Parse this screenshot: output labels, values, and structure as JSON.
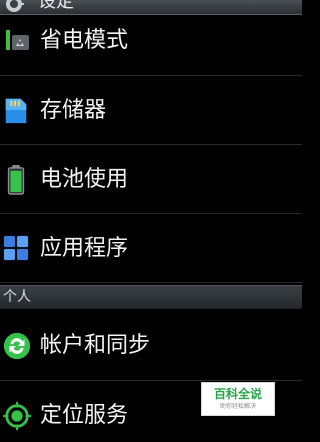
{
  "header": {
    "title": "设定",
    "icon": "gear-icon"
  },
  "items": [
    {
      "label": "省电模式",
      "icon": "power-saving-icon"
    },
    {
      "label": "存储器",
      "icon": "storage-icon"
    },
    {
      "label": "电池使用",
      "icon": "battery-icon"
    },
    {
      "label": "应用程序",
      "icon": "apps-grid-icon"
    }
  ],
  "section": {
    "label": "个人"
  },
  "personal_items": [
    {
      "label": "帐户和同步",
      "icon": "sync-icon"
    },
    {
      "label": "定位服务",
      "icon": "location-icon"
    }
  ],
  "watermark": {
    "title": "百科全说",
    "subtitle": "助你轻松解决"
  },
  "colors": {
    "background": "#000000",
    "accent_green": "#36c24a",
    "storage_blue": "#2a8fe6",
    "section_bar": "#30353a"
  }
}
